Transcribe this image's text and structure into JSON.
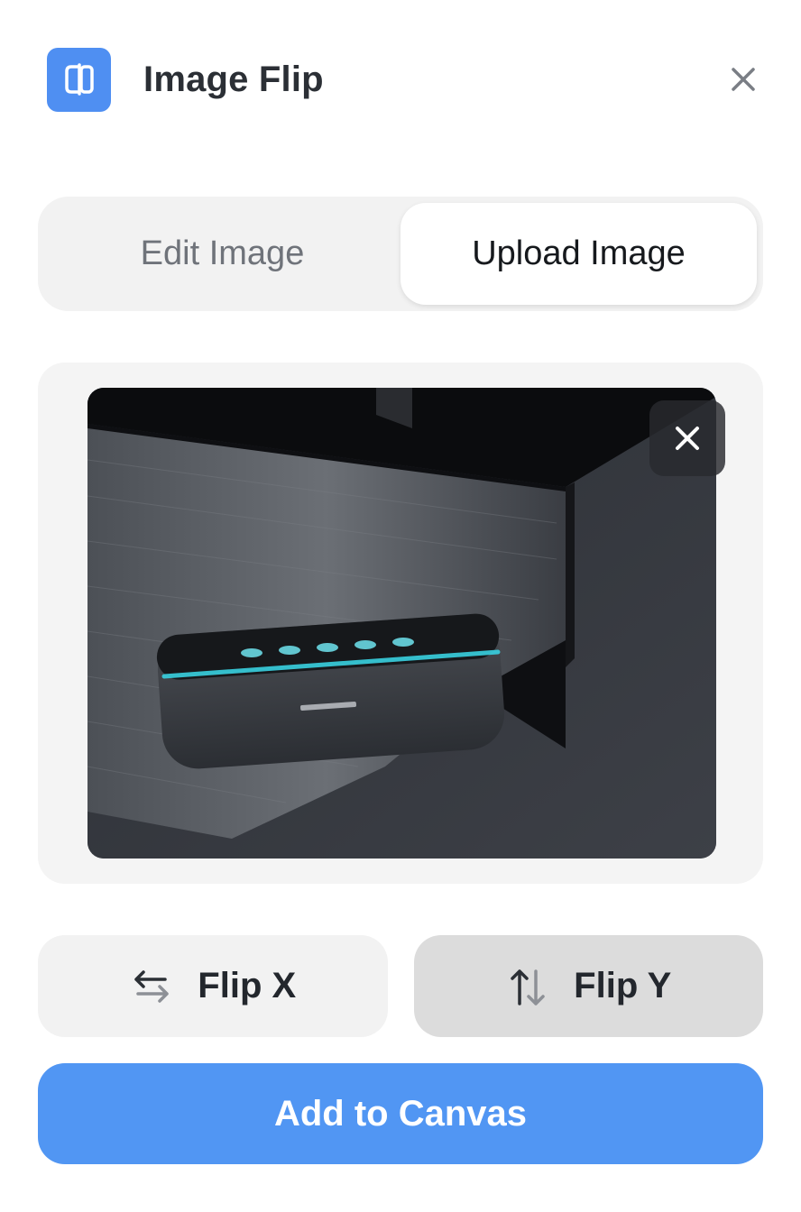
{
  "app": {
    "title": "Image Flip",
    "icon": "flip-app-icon",
    "accent_color": "#4f8ff2"
  },
  "header": {
    "close_icon": "close-icon"
  },
  "tabs": [
    {
      "label": "Edit Image",
      "active": false
    },
    {
      "label": "Upload Image",
      "active": true
    }
  ],
  "preview": {
    "image_subject": "speaker-photo",
    "remove_icon": "close-icon"
  },
  "actions": {
    "flip_x": {
      "label": "Flip X",
      "icon": "swap-horizontal-icon"
    },
    "flip_y": {
      "label": "Flip Y",
      "icon": "swap-vertical-icon"
    },
    "add": {
      "label": "Add to Canvas",
      "color": "#5196f3"
    }
  }
}
